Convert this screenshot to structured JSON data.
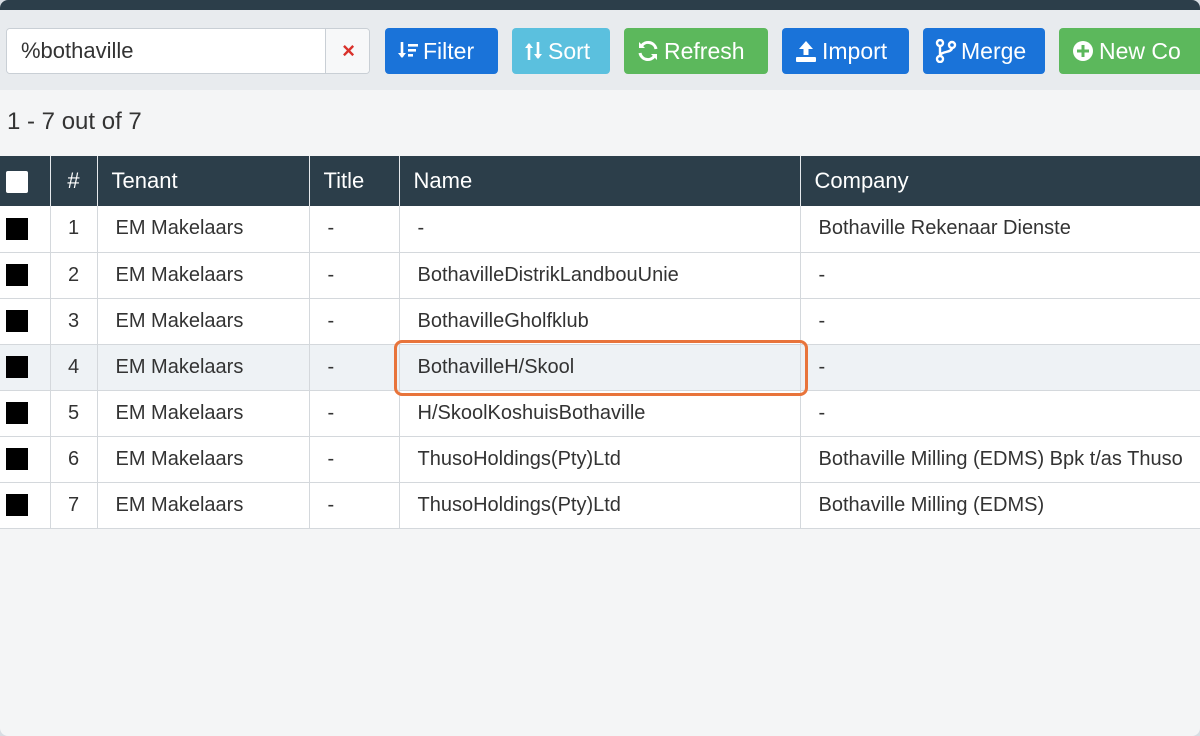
{
  "search": {
    "value": "%bothaville",
    "clear_icon": "×"
  },
  "toolbar": {
    "filter_label": "Filter",
    "sort_label": "Sort",
    "refresh_label": "Refresh",
    "import_label": "Import",
    "merge_label": "Merge",
    "new_contact_label": "New Co",
    "icons": [
      "filter-icon",
      "sort-icon",
      "refresh-icon",
      "upload-icon",
      "merge-icon",
      "plus-circle-icon"
    ],
    "colors": {
      "primary": "#1a73d9",
      "info": "#5bc0de",
      "success": "#5cb85c",
      "clear": "#d9312b"
    }
  },
  "summary": {
    "text": "1 - 7 out of 7"
  },
  "table": {
    "headers": {
      "number": "#",
      "tenant": "Tenant",
      "title": "Title",
      "name": "Name",
      "company": "Company"
    },
    "rows": [
      {
        "number": "1",
        "tenant": "EM Makelaars",
        "title": "-",
        "name": "-",
        "company": "Bothaville Rekenaar Dienste"
      },
      {
        "number": "2",
        "tenant": "EM Makelaars",
        "title": "-",
        "name": "BothavilleDistrikLandbouUnie",
        "company": "-"
      },
      {
        "number": "3",
        "tenant": "EM Makelaars",
        "title": "-",
        "name": "BothavilleGholfklub",
        "company": "-"
      },
      {
        "number": "4",
        "tenant": "EM Makelaars",
        "title": "-",
        "name": "BothavilleH/Skool",
        "company": "-"
      },
      {
        "number": "5",
        "tenant": "EM Makelaars",
        "title": "-",
        "name": "H/SkoolKoshuisBothaville",
        "company": "-"
      },
      {
        "number": "6",
        "tenant": "EM Makelaars",
        "title": "-",
        "name": "ThusoHoldings(Pty)Ltd",
        "company": "Bothaville Milling (EDMS) Bpk t/as Thuso"
      },
      {
        "number": "7",
        "tenant": "EM Makelaars",
        "title": "-",
        "name": "ThusoHoldings(Pty)Ltd",
        "company": "Bothaville Milling (EDMS)"
      }
    ],
    "highlighted_row": 4,
    "highlight_color": "#e8743b",
    "header_bg": "#2c3e4a"
  }
}
